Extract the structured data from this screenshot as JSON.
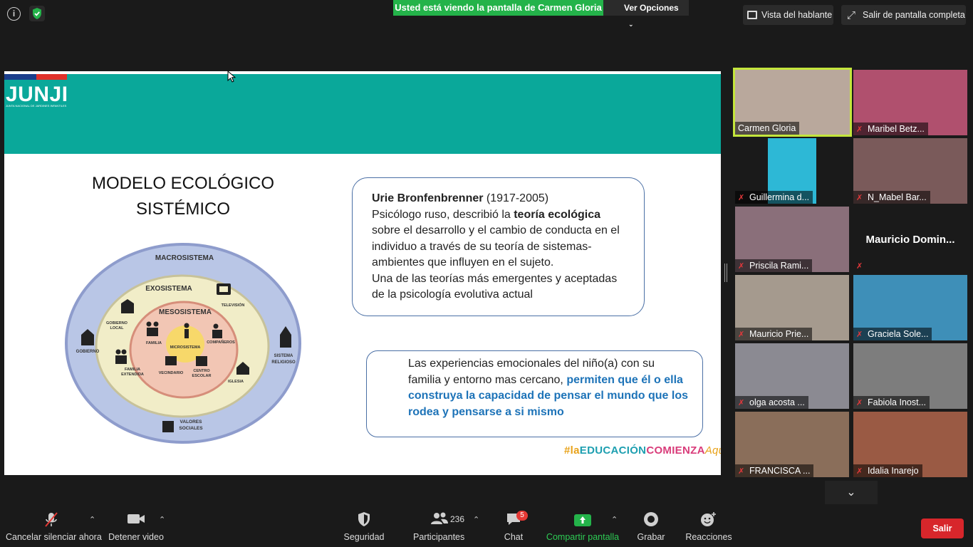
{
  "topbar": {
    "share_banner": "Usted está viendo la pantalla de Carmen Gloria",
    "view_options": "Ver Opciones",
    "speaker_view": "Vista del hablante",
    "exit_fullscreen": "Salir de pantalla completa"
  },
  "slide": {
    "logo": "JUNJI",
    "logo_sub": "JUNTA NACIONAL DE JARDINES INFANTILES",
    "title_line1": "MODELO ECOLÓGICO",
    "title_line2": "SISTÉMICO",
    "diagram": {
      "macro": "MACROSISTEMA",
      "exo": "EXOSISTEMA",
      "meso": "MESOSISTEMA",
      "micro": "MICROSISTEMA",
      "television": "TELEVISIÓN",
      "gobierno_local_1": "GOBIERNO",
      "gobierno_local_2": "LOCAL",
      "familia": "FAMILIA",
      "companeros": "COMPAÑEROS",
      "vecindario": "VECINDARIO",
      "centro_escolar_1": "CENTRO",
      "centro_escolar_2": "ESCOLAR",
      "familia_extendida_1": "FAMILIA",
      "familia_extendida_2": "EXTENDIDA",
      "iglesia": "IGLESIA",
      "gobierno": "GOBIERNO",
      "sistema_religioso_1": "SISTEMA",
      "sistema_religioso_2": "RELIGIOSO",
      "valores_1": "VALORES",
      "valores_2": "SOCIALES"
    },
    "box1": {
      "author": "Urie Bronfenbrenner",
      "years": " (1917-2005)",
      "line2_a": "Psicólogo ruso, describió la ",
      "line2_b": "teoría ecológica",
      "rest": "sobre el desarrollo y el cambio de conducta en el individuo a través de su teoría de sistemas-ambientes que influyen en el sujeto.",
      "line_last": "Una de las teorías más emergentes y aceptadas de la psicología evolutiva actual"
    },
    "box2": {
      "plain": "Las experiencias emocionales del niño(a) con su familia y entorno mas cercano, ",
      "bold": "permiten que él o ella construya la capacidad de pensar el mundo que los rodea y pensarse a si mismo"
    },
    "hashtag": {
      "a": "#la",
      "b": "EDUCACIÓN",
      "c": "COMIENZA",
      "d": "Aquí"
    }
  },
  "participants": [
    {
      "name": "Carmen Gloria",
      "muted": false,
      "bg": "#b9a89c"
    },
    {
      "name": "Maribel Betz...",
      "muted": true,
      "bg": "#b0506e"
    },
    {
      "name": "Guillermina d...",
      "muted": true,
      "bg": "#1a1a1a"
    },
    {
      "name": "N_Mabel Bar...",
      "muted": true,
      "bg": "#7a5a5a"
    },
    {
      "name": "Priscila Rami...",
      "muted": true,
      "bg": "#8a6f7a"
    },
    {
      "name": "Mauricio  Domin...",
      "muted": true,
      "bg": "#1a1a1a"
    },
    {
      "name": "Mauricio Prie...",
      "muted": true,
      "bg": "#a59a8e"
    },
    {
      "name": "Graciela Sole...",
      "muted": true,
      "bg": "#3e8fb8"
    },
    {
      "name": "olga acosta ...",
      "muted": true,
      "bg": "#8b8a92"
    },
    {
      "name": "Fabiola Inost...",
      "muted": true,
      "bg": "#7d7d7d"
    },
    {
      "name": "FRANCISCA ...",
      "muted": true,
      "bg": "#8a6e5a"
    },
    {
      "name": "Idalia Inarejo",
      "muted": true,
      "bg": "#9a5a44"
    }
  ],
  "toolbar": {
    "mute": "Cancelar silenciar ahora",
    "video": "Detener video",
    "security": "Seguridad",
    "participants": "Participantes",
    "participants_count": "236",
    "chat": "Chat",
    "chat_badge": "5",
    "share": "Compartir pantalla",
    "record": "Grabar",
    "reactions": "Reacciones",
    "leave": "Salir"
  },
  "colors": {
    "slide_header": "#0aa89a",
    "share_green": "#24b34a",
    "leave_red": "#d7262b",
    "active_speaker": "#c4e63c"
  }
}
